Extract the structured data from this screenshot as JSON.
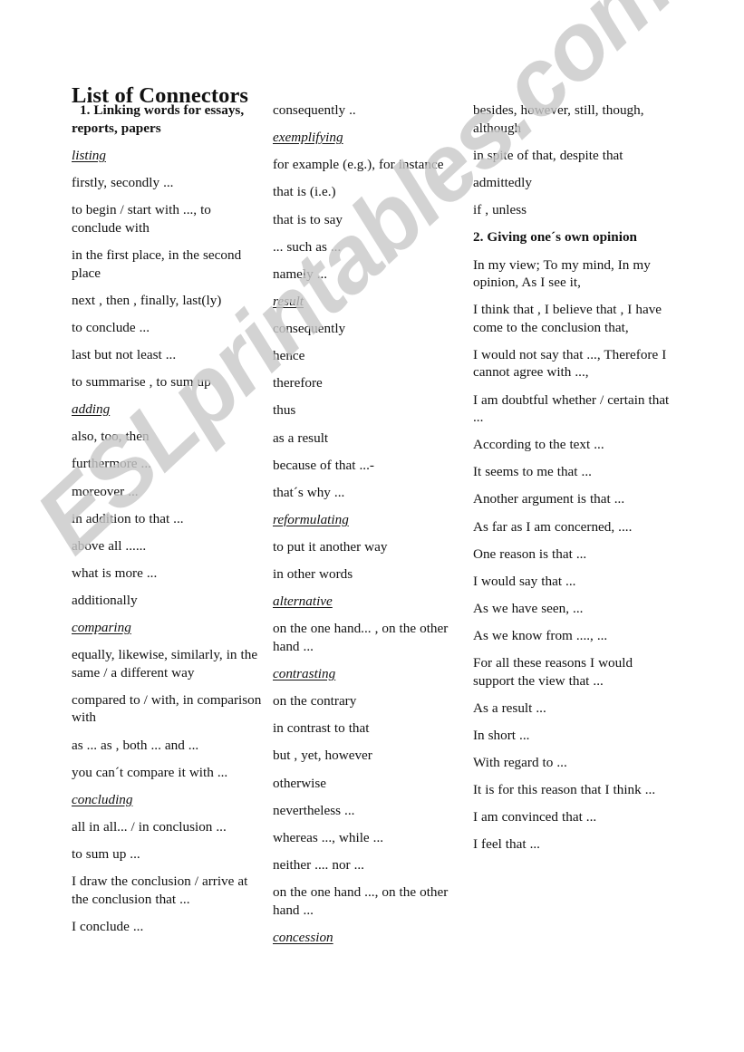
{
  "document": {
    "title": "List of Connectors",
    "watermark": "ESLprintables.com",
    "watermark_color": "#c9c9c9",
    "page_background": "#ffffff",
    "text_color": "#111111"
  },
  "columns": [
    {
      "id": "column-1",
      "entries": [
        {
          "kind": "section",
          "text": "1. Linking words for essays, reports, papers",
          "indent": true
        },
        {
          "kind": "category",
          "text": "listing "
        },
        {
          "kind": "item",
          "text": "firstly, secondly ..."
        },
        {
          "kind": "item",
          "text": "to begin / start with ..., to conclude with"
        },
        {
          "kind": "item",
          "text": "in the first place, in the second place"
        },
        {
          "kind": "item",
          "text": "next , then , finally, last(ly)"
        },
        {
          "kind": "item",
          "text": "to conclude ..."
        },
        {
          "kind": "item",
          "text": "last but not least ..."
        },
        {
          "kind": "item",
          "text": "to summarise , to sum up"
        },
        {
          "kind": "category",
          "text": "adding"
        },
        {
          "kind": "item",
          "text": "also, too, then"
        },
        {
          "kind": "item",
          "text": "furthermore ..."
        },
        {
          "kind": "item",
          "text": "moreover ..."
        },
        {
          "kind": "item",
          "text": "in addition to that ..."
        },
        {
          "kind": "item",
          "text": "above all ......"
        },
        {
          "kind": "item",
          "text": "what is more ..."
        },
        {
          "kind": "item",
          "text": "additionally"
        },
        {
          "kind": "category",
          "text": "comparing"
        },
        {
          "kind": "item",
          "text": "equally, likewise, similarly, in the same / a different way"
        },
        {
          "kind": "item",
          "text": "compared to / with, in comparison with"
        },
        {
          "kind": "item",
          "text": "as ... as , both ... and ..."
        },
        {
          "kind": "item",
          "text": "you can´t compare it with ..."
        },
        {
          "kind": "category",
          "text": "concluding"
        },
        {
          "kind": "item",
          "text": "all in all...  /  in conclusion ..."
        },
        {
          "kind": "item",
          "text": "to sum up ..."
        },
        {
          "kind": "item",
          "text": "I draw the conclusion / arrive at the conclusion that ..."
        },
        {
          "kind": "item",
          "text": "I conclude ..."
        }
      ]
    },
    {
      "id": "column-2",
      "entries": [
        {
          "kind": "item",
          "text": "consequently .."
        },
        {
          "kind": "category",
          "text": "exemplifying"
        },
        {
          "kind": "item",
          "text": "for example (e.g.), for instance"
        },
        {
          "kind": "item",
          "text": "that is (i.e.)"
        },
        {
          "kind": "item",
          "text": "that is to say"
        },
        {
          "kind": "item",
          "text": "... such as ..."
        },
        {
          "kind": "item",
          "text": "namely ..."
        },
        {
          "kind": "category",
          "text": "result"
        },
        {
          "kind": "item",
          "text": "consequently"
        },
        {
          "kind": "item",
          "text": "hence"
        },
        {
          "kind": "item",
          "text": "therefore"
        },
        {
          "kind": "item",
          "text": "thus"
        },
        {
          "kind": "item",
          "text": "as a result"
        },
        {
          "kind": "item",
          "text": "because of that ...-"
        },
        {
          "kind": "item",
          "text": "that´s why ..."
        },
        {
          "kind": "category",
          "text": "reformulating"
        },
        {
          "kind": "item",
          "text": " to put it another way"
        },
        {
          "kind": "item",
          "text": "in other words"
        },
        {
          "kind": "category",
          "text": "alternative"
        },
        {
          "kind": "item",
          "text": "on the one hand... , on the other hand ..."
        },
        {
          "kind": "category",
          "text": "contrasting"
        },
        {
          "kind": "item",
          "text": "on the contrary"
        },
        {
          "kind": "item",
          "text": "in contrast to that"
        },
        {
          "kind": "item",
          "text": "but , yet, however"
        },
        {
          "kind": "item",
          "text": "otherwise"
        },
        {
          "kind": "item",
          "text": "nevertheless ..."
        },
        {
          "kind": "item",
          "text": "whereas ..., while ..."
        },
        {
          "kind": "item",
          "text": "neither .... nor ..."
        },
        {
          "kind": "item",
          "text": "on the one hand ..., on the other hand ..."
        },
        {
          "kind": "category",
          "text": "concession"
        }
      ]
    },
    {
      "id": "column-3",
      "entries": [
        {
          "kind": "item",
          "text": "besides, however, still, though, although"
        },
        {
          "kind": "item",
          "text": "in spite of that, despite that"
        },
        {
          "kind": "item",
          "text": "admittedly"
        },
        {
          "kind": "item",
          "text": "if , unless"
        },
        {
          "kind": "section",
          "text": "2. Giving one´s own opinion"
        },
        {
          "kind": "item",
          "text": "In my view; To my mind, In my opinion, As I see it,"
        },
        {
          "kind": "item",
          "text": "I think that , I believe that , I have come to the conclusion that,"
        },
        {
          "kind": "item",
          "text": "I would not say that ..., Therefore I cannot agree with ...,"
        },
        {
          "kind": "item",
          "text": "I am doubtful whether / certain that ..."
        },
        {
          "kind": "item",
          "text": "According to the text ..."
        },
        {
          "kind": "item",
          "text": "It seems to me that ..."
        },
        {
          "kind": "item",
          "text": "Another argument is that ..."
        },
        {
          "kind": "item",
          "text": "As far as I am concerned, ...."
        },
        {
          "kind": "item",
          "text": "One reason is that ..."
        },
        {
          "kind": "item",
          "text": "I would say that ..."
        },
        {
          "kind": "item",
          "text": "As we have seen, ..."
        },
        {
          "kind": "item",
          "text": "As we know from ...., ..."
        },
        {
          "kind": "item",
          "text": "For all these reasons I would support the view that ..."
        },
        {
          "kind": "item",
          "text": "As a result ..."
        },
        {
          "kind": "item",
          "text": "In short ..."
        },
        {
          "kind": "item",
          "text": "With regard to ..."
        },
        {
          "kind": "item",
          "text": "It is for this reason that I think ..."
        },
        {
          "kind": "item",
          "text": "I am convinced that ..."
        },
        {
          "kind": "item",
          "text": "I feel that ..."
        }
      ]
    }
  ]
}
